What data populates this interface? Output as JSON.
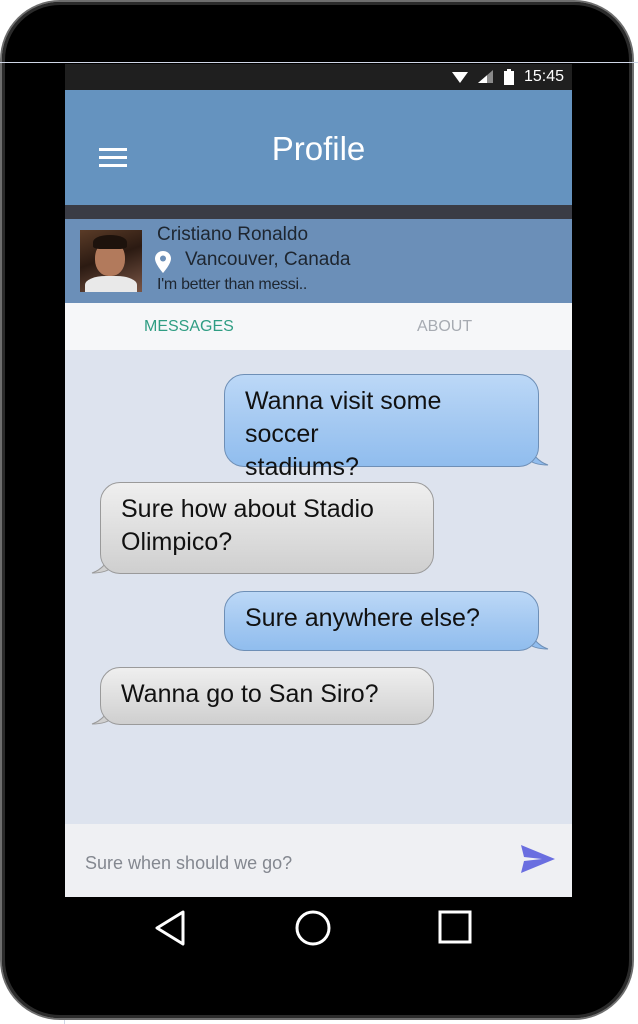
{
  "status_bar": {
    "time": "15:45",
    "icons": [
      "wifi-icon",
      "signal-icon",
      "battery-icon"
    ]
  },
  "app_bar": {
    "title": "Profile",
    "menu_icon": "hamburger-menu-icon"
  },
  "profile": {
    "name": "Cristiano Ronaldo",
    "location": "Vancouver, Canada",
    "location_icon": "location-pin-icon",
    "bio": "I'm better than messi.."
  },
  "tabs": [
    {
      "label": "MESSAGES",
      "active": true
    },
    {
      "label": "ABOUT",
      "active": false
    }
  ],
  "messages": [
    {
      "direction": "outgoing",
      "lines": [
        "Wanna visit some soccer",
        "stadiums?"
      ]
    },
    {
      "direction": "incoming",
      "lines": [
        "Sure how about Stadio",
        "Olimpico?"
      ]
    },
    {
      "direction": "outgoing",
      "lines": [
        "Sure anywhere else?"
      ]
    },
    {
      "direction": "incoming",
      "lines": [
        "Wanna go to San Siro?"
      ]
    }
  ],
  "composer": {
    "placeholder": "Sure when should we go?",
    "send_icon": "send-icon"
  },
  "navigation": {
    "back_icon": "back-triangle-icon",
    "home_icon": "home-circle-icon",
    "recents_icon": "recents-square-icon"
  },
  "colors": {
    "app_bar": "#6593bf",
    "profile_bg": "#6b8fb8",
    "active_tab": "#2f9d83",
    "inactive_tab": "#a7abb2",
    "chat_bg": "#dde3ee",
    "send_icon": "#6a6ee0"
  }
}
